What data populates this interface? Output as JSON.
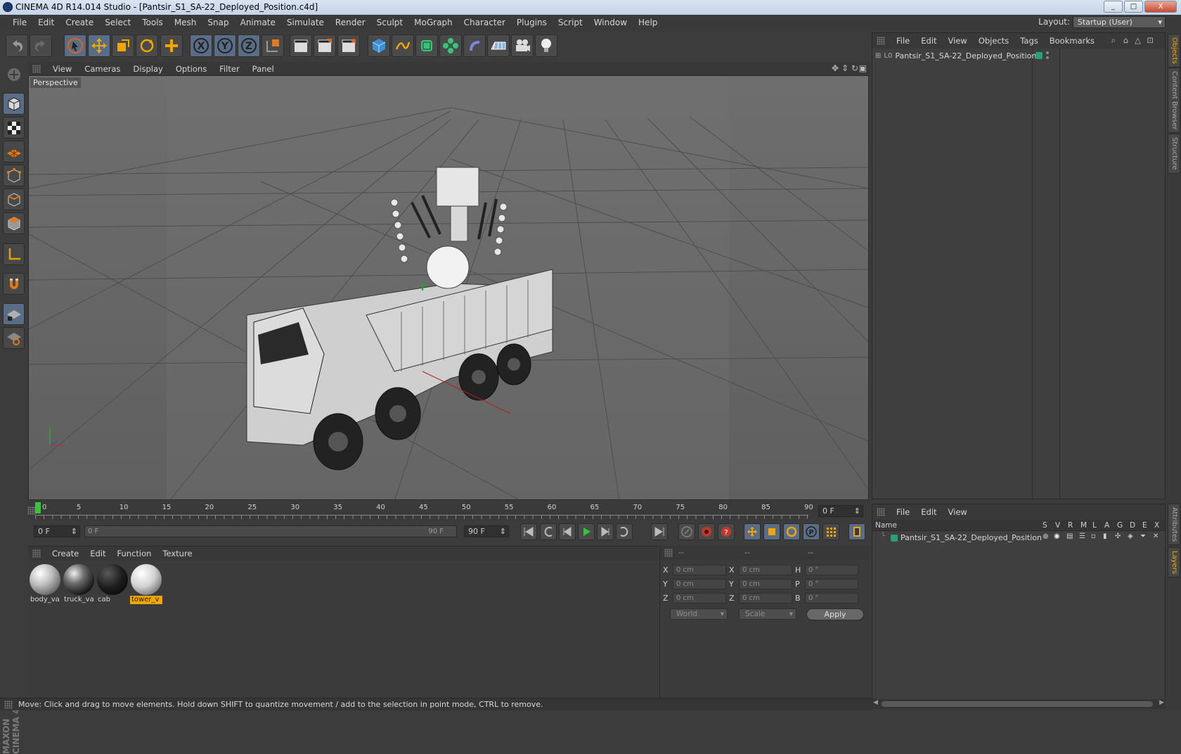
{
  "window": {
    "title": "CINEMA 4D R14.014 Studio - [Pantsir_S1_SA-22_Deployed_Position.c4d]",
    "buttons": [
      "_",
      "□",
      "X"
    ]
  },
  "menubar": [
    "File",
    "Edit",
    "Create",
    "Select",
    "Tools",
    "Mesh",
    "Snap",
    "Animate",
    "Simulate",
    "Render",
    "Sculpt",
    "MoGraph",
    "Character",
    "Plugins",
    "Script",
    "Window",
    "Help"
  ],
  "layout": {
    "label": "Layout:",
    "value": "Startup (User)"
  },
  "viewport": {
    "menu": [
      "View",
      "Cameras",
      "Display",
      "Options",
      "Filter",
      "Panel"
    ],
    "label": "Perspective"
  },
  "timeline": {
    "ticks": [
      "0",
      "5",
      "10",
      "15",
      "20",
      "25",
      "30",
      "35",
      "40",
      "45",
      "50",
      "55",
      "60",
      "65",
      "70",
      "75",
      "80",
      "85",
      "90"
    ],
    "current_frame": "0 F",
    "start_field": "0 F",
    "slider_start": "0 F",
    "slider_end": "90 F",
    "end_field": "90 F"
  },
  "materials": {
    "menu": [
      "Create",
      "Edit",
      "Function",
      "Texture"
    ],
    "items": [
      {
        "name": "body_va",
        "active": false
      },
      {
        "name": "truck_va",
        "active": false
      },
      {
        "name": "cab",
        "active": false
      },
      {
        "name": "tower_v",
        "active": true
      }
    ]
  },
  "coords": {
    "header": [
      "--",
      "--",
      "--"
    ],
    "rows": [
      {
        "a": "X",
        "av": "0 cm",
        "b": "X",
        "bv": "0 cm",
        "c": "H",
        "cv": "0 °"
      },
      {
        "a": "Y",
        "av": "0 cm",
        "b": "Y",
        "bv": "0 cm",
        "c": "P",
        "cv": "0 °"
      },
      {
        "a": "Z",
        "av": "0 cm",
        "b": "Z",
        "bv": "0 cm",
        "c": "B",
        "cv": "0 °"
      }
    ],
    "space": "World",
    "mode": "Scale",
    "apply": "Apply"
  },
  "objects_panel": {
    "menu": [
      "File",
      "Edit",
      "View",
      "Objects",
      "Tags",
      "Bookmarks"
    ],
    "tree": [
      {
        "name": "Pantsir_S1_SA-22_Deployed_Position"
      }
    ]
  },
  "layers_panel": {
    "menu": [
      "File",
      "Edit",
      "View"
    ],
    "columns": [
      "Name",
      "S",
      "V",
      "R",
      "M",
      "L",
      "A",
      "G",
      "D",
      "E",
      "X"
    ],
    "rows": [
      {
        "name": "Pantsir_S1_SA-22_Deployed_Position"
      }
    ]
  },
  "side_tabs": [
    "Objects",
    "Content Browser",
    "Structure",
    "Attributes",
    "Layers"
  ],
  "status": "Move: Click and drag to move elements. Hold down SHIFT to quantize movement / add to the selection in point mode, CTRL to remove.",
  "brand": "MAXON CINEMA 4D"
}
